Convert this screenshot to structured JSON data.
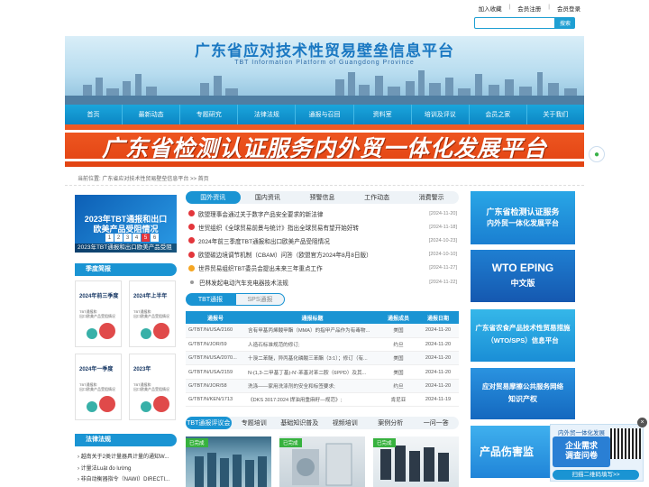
{
  "top_links": [
    "加入收藏",
    "会员注册",
    "会员登录"
  ],
  "top_sep": "|",
  "search": {
    "placeholder": "",
    "button": "搜索"
  },
  "banner": {
    "title": "广东省应对技术性贸易壁垒信息平台",
    "subtitle": "TBT Information Platform of Guangdong Province"
  },
  "nav": [
    "首页",
    "最新动态",
    "专题研究",
    "法律法规",
    "通报与召回",
    "资料室",
    "培训及评议",
    "会员之家",
    "关于我们"
  ],
  "promo": "广东省检测认证服务内外贸一体化发展平台",
  "breadcrumb": "当前位置:  广东省应对技术性贸易壁垒信息平台 >> 首页",
  "slide": {
    "title_line1": "2023年TBT通报和出口",
    "title_line2": "欧美产品受阻情况",
    "caption": "2023年TBT通报和出口欧美产品受阻",
    "pages": [
      "1",
      "2",
      "3",
      "4",
      "5",
      "6"
    ],
    "active_page": 4
  },
  "quarterly": {
    "heading": "季度简报",
    "items": [
      {
        "title1": "2024年前三季度",
        "title2": "",
        "lines": "TBT通报和\n出口欧美产品受阻情况"
      },
      {
        "title1": "2024年上半年",
        "title2": "",
        "lines": "TBT通报和\n出口欧美产品受阻情况"
      },
      {
        "title1": "2024年一季度",
        "title2": "",
        "lines": "TBT通报和\n出口欧美产品受阻情况"
      },
      {
        "title1": "2023年",
        "title2": "",
        "lines": "TBT通报和\n出口欧美产品受阻情况"
      }
    ]
  },
  "laws": {
    "heading": "法律法规",
    "items": [
      "越南关于2类计量器具计量的通知W...",
      "计量法Luật đo lường",
      "非自动衡器指令（NAWI）DIRECTI..."
    ]
  },
  "news_tabs": [
    "国外资讯",
    "国内资讯",
    "预警信息",
    "工作动态",
    "消费警示"
  ],
  "news": [
    {
      "title": "欧盟理事会通过关于数字产品安全要求的新法律",
      "date": "[2024-11-20]",
      "icon": "red"
    },
    {
      "title": "世贸组织《全球贸易前景与统计》指出全球贸易有望开始好转",
      "date": "[2024-11-18]",
      "icon": "red"
    },
    {
      "title": "2024年前三季度TBT通报和出口欧美产品受阻情况",
      "date": "[2024-10-23]",
      "icon": "red"
    },
    {
      "title": "欧盟碳边境调节机制（CBAM）问答（欧盟官方2024年8月8日版）",
      "date": "[2024-10-10]",
      "icon": "red"
    },
    {
      "title": "世界贸易组织TBT委员会提出未来三年重点工作",
      "date": "[2024-11-27]",
      "icon": "orange"
    },
    {
      "title": "巴林发起电动汽车充电器技术法规",
      "date": "[2024-11-22]",
      "icon": "bullet"
    }
  ],
  "tbt_tabs": [
    "TBT通报",
    "SPS通报"
  ],
  "tbt_table": {
    "headers": [
      "通报号",
      "通报标题",
      "通报成员",
      "通报日期"
    ],
    "rows": [
      [
        "G/TBT/N/USA/2160",
        "含有甲基丙烯酸甲酯（MMA）的指甲产品作为有毒物...",
        "美国",
        "2024-11-20"
      ],
      [
        "G/TBT/N/JOR/59",
        "人造石标准规范的修订;",
        "约旦",
        "2024-11-20"
      ],
      [
        "G/TBT/N/USA/2070...",
        "十溴二苯醚，异丙基化磷酸三苯酯（3:1）；修订（有...",
        "美国",
        "2024-11-20"
      ],
      [
        "G/TBT/N/USA/2159",
        "N-(1,3-二甲基丁基)-N'-苯基对苯二胺（6PPD）及其...",
        "美国",
        "2024-11-20"
      ],
      [
        "G/TBT/N/JOR/58",
        "洗涤——家用洗涤剂的安全和标签要求;",
        "约旦",
        "2024-11-20"
      ],
      [
        "G/TBT/N/KEN/1713",
        "《DKS 3017:2024 焊油用重麻籽—规范》;",
        "肯尼亚",
        "2024-11-19"
      ]
    ]
  },
  "bottom_tabs": [
    "TBT通报评议会",
    "专题培训",
    "基础知识普及",
    "视频培训",
    "案例分析",
    "一问一答"
  ],
  "bottom_pics": [
    "已完成",
    "已完成",
    "已完成"
  ],
  "right_ads": [
    {
      "line1": "广东省检测认证服务",
      "line2": "内外贸一体化发展平台",
      "color": "#1a8fd8"
    },
    {
      "line1": "WTO EPING",
      "line2": "中文版",
      "color": "#1a63b8"
    },
    {
      "line1": "广东省农食产品技术性贸易措施",
      "line2": "（WTO/SPS）信息平台",
      "color": "#1aa0d8"
    },
    {
      "line1": "应对贸易摩擦公共服务网络",
      "line2": "知识产权",
      "color": "#1a7fcc"
    },
    {
      "line1": "产品伤害监",
      "line2": "",
      "color": "#2a9be0"
    }
  ],
  "floater": {
    "top": "内外贸一体化发展",
    "main1": "企业需求",
    "main2": "调查问卷",
    "bottom": "扫描二维码填写>>",
    "close": "×"
  },
  "wechat": "微"
}
